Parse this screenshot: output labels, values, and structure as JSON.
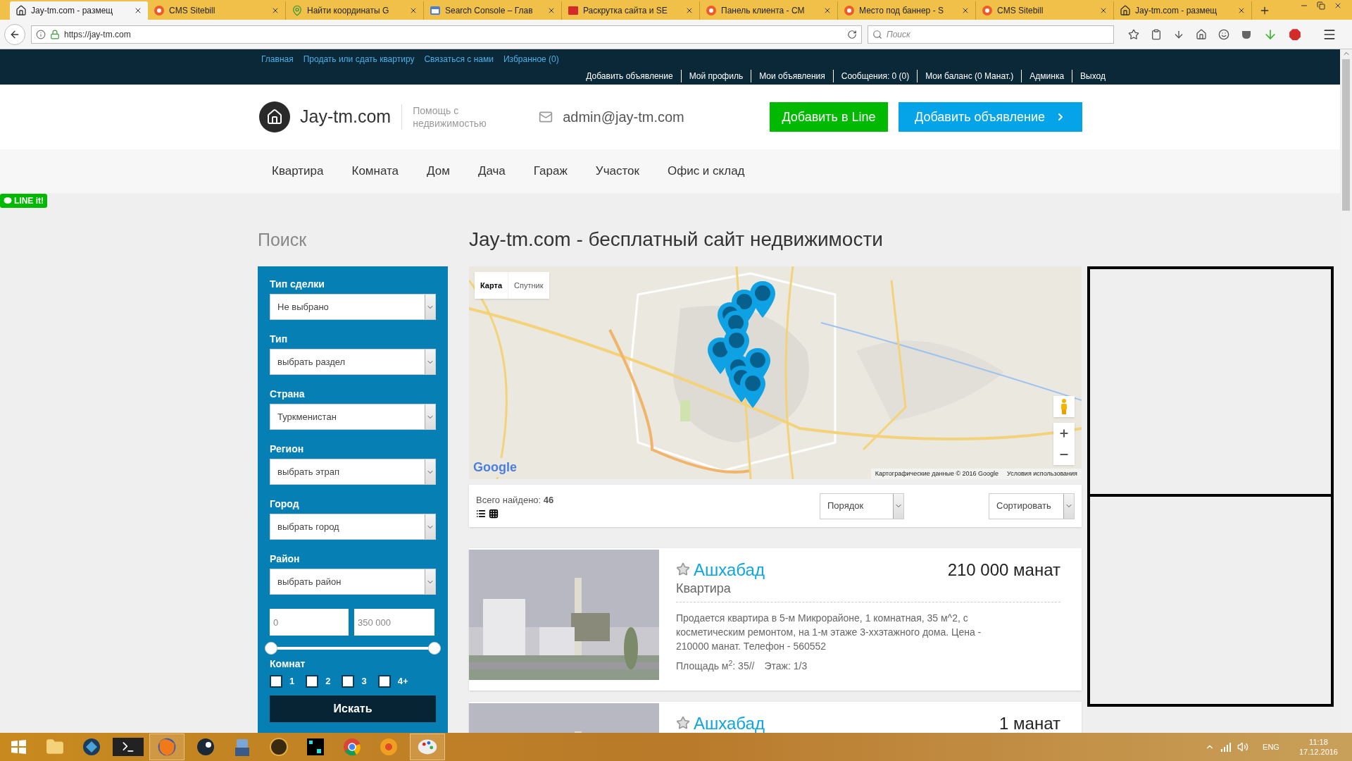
{
  "browser": {
    "tabs": [
      {
        "title": "Jay-tm.com - размещ",
        "selected": true
      },
      {
        "title": "CMS Sitebill",
        "selected": false
      },
      {
        "title": "Найти координаты G",
        "selected": false
      },
      {
        "title": "Search Console – Глав",
        "selected": false
      },
      {
        "title": "Раскрутка сайта и SE",
        "selected": false
      },
      {
        "title": "Панель клиента - CM",
        "selected": false
      },
      {
        "title": "Место под баннер - S",
        "selected": false
      },
      {
        "title": "CMS Sitebill",
        "selected": false
      },
      {
        "title": "Jay-tm.com - размещ",
        "selected": false
      }
    ],
    "url": "https://jay-tm.com",
    "search_placeholder": "Поиск"
  },
  "top_nav": {
    "links": [
      "Главная",
      "Продать или сдать квартиру",
      "Связаться с нами",
      "Избранное (0)"
    ],
    "user_menu": [
      "Добавить объявление",
      "Мой профиль",
      "Мои объявления",
      "Сообщения: 0 (0)",
      "Мои баланс (0 Манат.)",
      "Админка",
      "Выход"
    ]
  },
  "header": {
    "site_name": "Jay-tm.com",
    "tagline": "Помощь с недвижимостью",
    "email": "admin@jay-tm.com",
    "buttons": [
      {
        "label": "Добавить в Line",
        "kind": "line"
      },
      {
        "label": "Добавить объявление",
        "kind": "primary"
      }
    ]
  },
  "categories": [
    "Квартира",
    "Комната",
    "Дом",
    "Дача",
    "Гараж",
    "Участок",
    "Офис и склад"
  ],
  "line_badge": "LINE it!",
  "search_panel": {
    "title": "Поиск",
    "fields": [
      {
        "label": "Тип сделки",
        "value": "Не выбрано"
      },
      {
        "label": "Тип",
        "value": "выбрать раздел"
      },
      {
        "label": "Страна",
        "value": "Туркменистан"
      },
      {
        "label": "Регион",
        "value": "выбрать этрап"
      },
      {
        "label": "Город",
        "value": "выбрать город"
      },
      {
        "label": "Район",
        "value": "выбрать район"
      }
    ],
    "price_min": "0",
    "price_max": "350 000",
    "slider": {
      "from": {
        "level": 0
      },
      "to": {
        "level": 1
      }
    },
    "rooms_label": "Комнат",
    "rooms": [
      {
        "label": "1",
        "checked": false
      },
      {
        "label": "2",
        "checked": false
      },
      {
        "label": "3",
        "checked": false
      },
      {
        "label": "4+",
        "checked": false
      }
    ],
    "submit": "Искать"
  },
  "page_title": "Jay-tm.com - бесплатный сайт недвижимости",
  "map": {
    "view_tabs": [
      {
        "label": "Карта",
        "selected": true
      },
      {
        "label": "Спутник",
        "selected": false
      }
    ],
    "logo": "Google",
    "attribution": "Картографические данные © 2016 Google",
    "terms": "Условия использования"
  },
  "results": {
    "found": "Всего найдено: **46**",
    "order": "Порядок",
    "sort": "Сортировать"
  },
  "listings": [
    {
      "city": "Ашхабад",
      "type": "Квартира",
      "price": "210 000 манат",
      "description": "Продается квартира в 5-м Микрорайоне, 1 комнатная, 35 м^2, с косметическим ремонтом, на 1-м этаже 3-ххэтажного дома. Цена - 210000 манат. Телефон - 560552",
      "area": "Площадь м$^{2}$: 35//",
      "floor": "Этаж: 1/3",
      "favorite": false
    },
    {
      "city": "Ашхабад",
      "price": "1 манат",
      "favorite": false
    }
  ],
  "taskbar": {
    "language": "ENG",
    "time": "11:18",
    "date": "17.12.2016"
  }
}
